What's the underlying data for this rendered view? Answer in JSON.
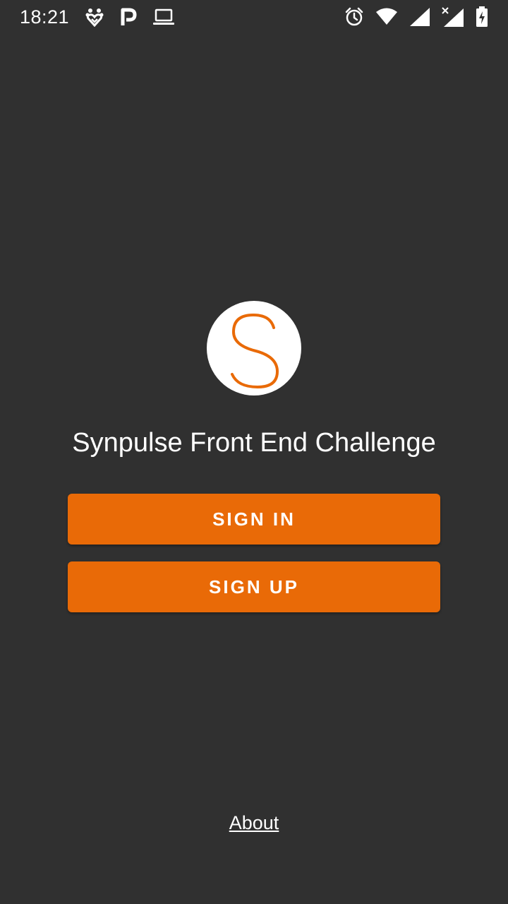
{
  "status_bar": {
    "time": "18:21",
    "left_icons": [
      "pets-heart-icon",
      "parking-p-icon",
      "laptop-icon"
    ],
    "right_icons": [
      "alarm-clock-icon",
      "wifi-icon",
      "cell-signal-icon",
      "cell-signal-no-service-icon",
      "battery-charging-icon"
    ]
  },
  "logo": {
    "letter": "S",
    "accent_color": "#E96A07",
    "background_color": "#FFFFFF"
  },
  "title": "Synpulse Front End Challenge",
  "buttons": {
    "sign_in": "SIGN IN",
    "sign_up": "SIGN UP",
    "color": "#E96A07"
  },
  "about": "About",
  "colors": {
    "background": "#303030",
    "text": "#FFFFFF",
    "accent": "#E96A07"
  }
}
